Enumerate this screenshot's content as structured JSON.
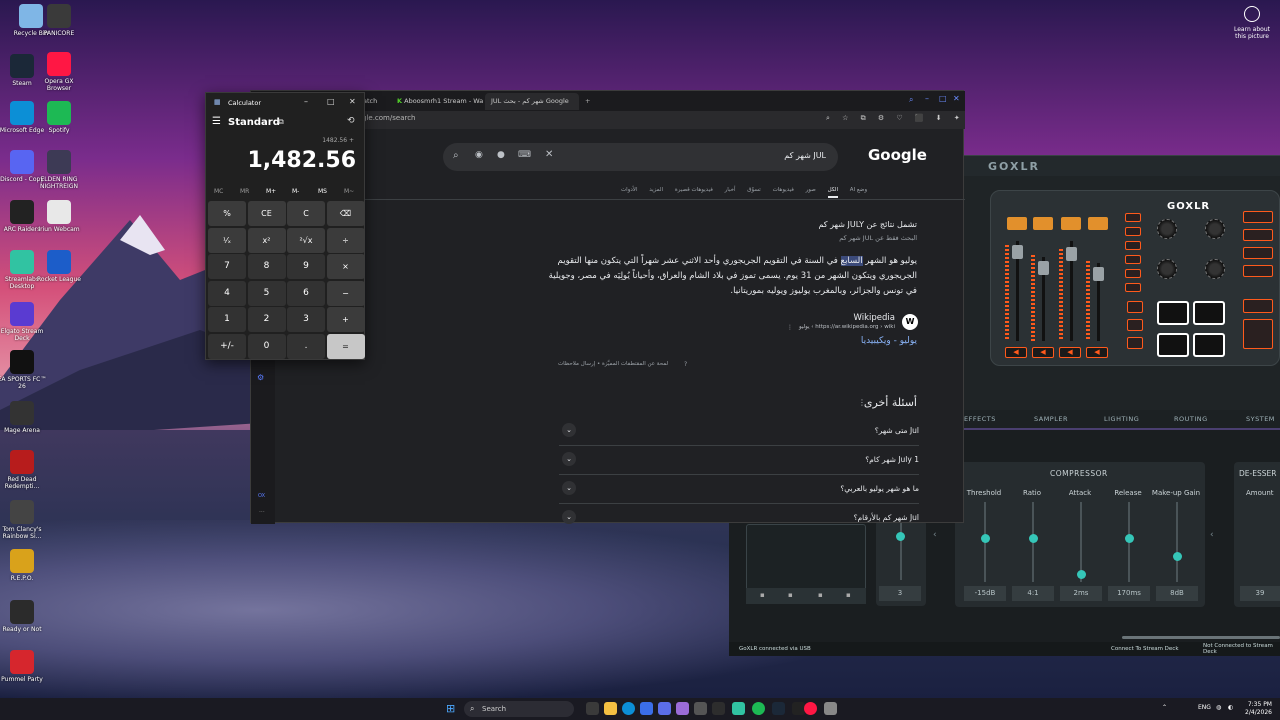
{
  "desktop": {
    "icons": [
      {
        "label": "Recycle Bin",
        "color": "#7fb6e6"
      },
      {
        "label": "PANICORE",
        "color": "#3a3a3a"
      },
      {
        "label": "Steam",
        "color": "#1b2838"
      },
      {
        "label": "Opera GX Browser",
        "color": "#ff1744"
      },
      {
        "label": "Microsoft Edge",
        "color": "#0c8fd6"
      },
      {
        "label": "Spotify",
        "color": "#1db954"
      },
      {
        "label": "Discord - Copy",
        "color": "#5865f2"
      },
      {
        "label": "ELDEN RING NIGHTREIGN",
        "color": "#3d3a55"
      },
      {
        "label": "ARC Raiders",
        "color": "#222222"
      },
      {
        "label": "Iriun Webcam",
        "color": "#e8e8e8"
      },
      {
        "label": "Streamlabs Desktop",
        "color": "#31c3a2"
      },
      {
        "label": "Rocket League",
        "color": "#1c5dc9"
      },
      {
        "label": "Elgato Stream Deck",
        "color": "#5a3bd1"
      },
      {
        "label": "EA SPORTS FC™ 26",
        "color": "#111111"
      },
      {
        "label": "Mage Arena",
        "color": "#333333"
      },
      {
        "label": "Red Dead Redempti...",
        "color": "#b71c1c"
      },
      {
        "label": "Tom Clancy's Rainbow Si...",
        "color": "#444444"
      },
      {
        "label": "R.E.P.O.",
        "color": "#d9a21b"
      },
      {
        "label": "Ready or Not",
        "color": "#2b2b2b"
      },
      {
        "label": "Pummel Party",
        "color": "#d6262d"
      }
    ],
    "learn_label": "Learn about this picture"
  },
  "goxlr": {
    "title": "GOXLR",
    "device_logo": "GOXLR",
    "tabs": [
      "EFFECTS",
      "SAMPLER",
      "LIGHTING",
      "ROUTING",
      "SYSTEM"
    ],
    "compressor_title": "COMPRESSOR",
    "deesser_title": "DE-ESSER",
    "params": [
      {
        "label": "Threshold",
        "value": "-15dB",
        "level": 0.55
      },
      {
        "label": "Ratio",
        "value": "4:1",
        "level": 0.55
      },
      {
        "label": "Attack",
        "value": "2ms",
        "level": 0.05
      },
      {
        "label": "Release",
        "value": "170ms",
        "level": 0.55
      },
      {
        "label": "Make-up Gain",
        "value": "8dB",
        "level": 0.3
      }
    ],
    "left_value": "3",
    "deesser_label": "Amount",
    "deesser_value": "39",
    "status_left": "GoXLR connected via USB",
    "status_mid": "Connect To Stream Deck",
    "status_right": "Not Connected to Stream Deck",
    "accent": "#35c6b8"
  },
  "browser": {
    "tabs": [
      {
        "label": "Watch"
      },
      {
        "label": "Aboosmrh1 Stream - Watc"
      },
      {
        "label": "JUL شهر كم - بحث Google"
      }
    ],
    "url": "google.com/search",
    "search_query": "JUL شهر كم",
    "logo": "Google",
    "search_tabs": [
      "وضع AI",
      "الكل",
      "صور",
      "فيديوهات",
      "تسوّق",
      "أخبار",
      "فيديوهات قصيرة",
      "المزيد",
      "الأدوات"
    ],
    "active_tab": "الكل",
    "result_head": "تشمل نتائج عن JULY شهر كم",
    "result_sub": "البحث فقط عن JUL شهر كم",
    "snippet_before": "يوليو هو الشهر ",
    "snippet_highlight": "السابع",
    "snippet_after": " في السنة في التقويم الجريجوري وأحد الاثني عشر شهراً التي يتكون منها التقويم الجريجوري ويتكون الشهر من 31 يوم. يسمى تموز في بلاد الشام والعراق، وأحياناً يُولِيَه في مصر، وجويلية في تونس والجزائر، وبالمغرب يوليوز ويوليه بموريتانيا.",
    "source_name": "Wikipedia",
    "source_url": "https://ar.wikipedia.org › wiki › يوليو",
    "wiki_icon": "W",
    "source_link": "يوليو - ويكيبيديا",
    "feedback": "لمحة عن المقتطفات المميَّزة  •  إرسال ملاحظات",
    "paa_title": "أسئلة أخرى",
    "questions": [
      "Jul متى شهر؟",
      "1 July شهر كام؟",
      "ما هو شهر يوليو بالعربي؟",
      "Jul شهر كم بالأرقام؟"
    ]
  },
  "calculator": {
    "title": "Calculator",
    "mode": "Standard",
    "expression": "1482.56 +",
    "display": "1,482.56",
    "memory": [
      "MC",
      "MR",
      "M+",
      "M-",
      "MS",
      "M~"
    ],
    "keys": [
      [
        "%",
        "CE",
        "C",
        "⌫"
      ],
      [
        "¹⁄ₓ",
        "x²",
        "²√x",
        "÷"
      ],
      [
        "7",
        "8",
        "9",
        "×"
      ],
      [
        "4",
        "5",
        "6",
        "−"
      ],
      [
        "1",
        "2",
        "3",
        "+"
      ],
      [
        "+/-",
        "0",
        ".",
        "="
      ]
    ]
  },
  "taskbar": {
    "search_placeholder": "Search",
    "tray_lang": "ENG",
    "time": "7:35 PM",
    "date": "2/4/2026"
  }
}
